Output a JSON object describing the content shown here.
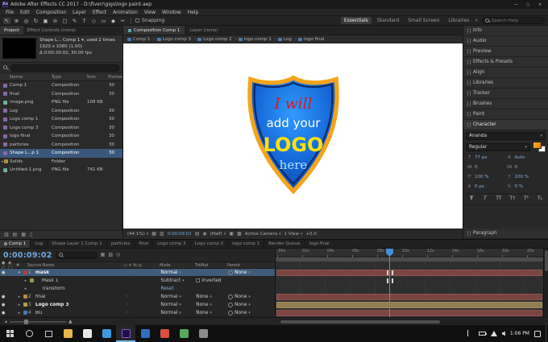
{
  "title_bar": {
    "app_icon": "Ae",
    "title": "Adobe After Effects CC 2017 - D:\\fiverr\\gigs\\logo paint.aep"
  },
  "menu": {
    "items": [
      "File",
      "Edit",
      "Composition",
      "Layer",
      "Effect",
      "Animation",
      "View",
      "Window",
      "Help"
    ]
  },
  "icons": {
    "minimize": "—",
    "maximize": "▢",
    "close": "✕",
    "selection_tool": "↖",
    "hand_tool": "⊕",
    "zoom_tool": "◎",
    "rotate_tool": "↻",
    "camera_tool": "▣",
    "pan_behind_tool": "⊘",
    "mask_tool": "□",
    "pen_tool": "✎",
    "type_tool": "T",
    "brush_tool": "◇",
    "clone_tool": "▭",
    "eraser_tool": "◆",
    "roto_tool": "✂",
    "workspace_more": "»",
    "grid_icon": "▦",
    "region_icon": "▧",
    "snapshot_icon": "▤",
    "channels_icon": "◉",
    "interpret_icon": "▥",
    "newfolder_icon": "▤",
    "newcomp_icon": "▦",
    "trash_icon": "▯",
    "eye": "●",
    "audio_icons": "● ◉ ○ □",
    "switch_icons": "◇ ✶ fx ◎"
  },
  "toolbar": {
    "snapping_label": "Snapping",
    "workspaces": [
      "Essentials",
      "Standard",
      "Small Screen",
      "Libraries"
    ],
    "search_placeholder": "Search Help"
  },
  "project": {
    "tabs": [
      "Project",
      "Effect Controls (none)"
    ],
    "info_line1": "Shape L... Comp 1 ▾, used 2 times",
    "info_line2": "1920 x 1080 (1.00)",
    "info_line3": "Δ 0:00:20:02, 30.00 fps",
    "columns": [
      "Name",
      "Type",
      "Size",
      "Frame.."
    ],
    "rows": [
      {
        "name": "Comp 1",
        "type": "Composition",
        "size": "",
        "frame": "30"
      },
      {
        "name": "final",
        "type": "Composition",
        "size": "",
        "frame": "30"
      },
      {
        "name": "image.png",
        "type": "PNG file",
        "size": "108 KB",
        "frame": ""
      },
      {
        "name": "Log",
        "type": "Composition",
        "size": "",
        "frame": "30"
      },
      {
        "name": "Logo comp 1",
        "type": "Composition",
        "size": "",
        "frame": "30"
      },
      {
        "name": "Logo comp 3",
        "type": "Composition",
        "size": "",
        "frame": "30"
      },
      {
        "name": "logo final",
        "type": "Composition",
        "size": "",
        "frame": "30"
      },
      {
        "name": "particles",
        "type": "Composition",
        "size": "",
        "frame": "30"
      },
      {
        "name": "Shape L...p 1",
        "type": "Composition",
        "size": "",
        "frame": "30"
      },
      {
        "name": "Solids",
        "type": "Folder",
        "size": "",
        "frame": ""
      },
      {
        "name": "Untitled-1.png",
        "type": "PNG file",
        "size": "741 KB",
        "frame": ""
      }
    ]
  },
  "viewer": {
    "tabs": [
      "Composition Comp 1",
      "Layer (none)"
    ],
    "breadcrumb": [
      "Comp 1",
      "Logo comp 3",
      "Logo comp 2",
      "logo comp 1",
      "Log",
      "logo final"
    ],
    "zoom": "(44.1%)",
    "timecode": "0:00:09:02",
    "resolution": "(Half)",
    "camera": "Active Camera",
    "views": "1 View",
    "exposure": "+0.0",
    "logo": {
      "line1": "I will",
      "line2": "add your",
      "line3": "LOGO",
      "line4": "here"
    }
  },
  "right_panel": {
    "panels": [
      "Info",
      "Audio",
      "Preview",
      "Effects & Presets",
      "Align",
      "Libraries",
      "Tracker",
      "Brushes",
      "Paint"
    ],
    "character": {
      "title": "Character",
      "font_family": "Ananda",
      "font_style": "Regular",
      "font_size": "77 px",
      "leading": "Auto",
      "kerning": "0",
      "tracking": "0",
      "vertical_scale": "100 %",
      "horizontal_scale": "100 %",
      "baseline_shift": "0 px",
      "tsume": "0 %"
    },
    "paragraph_title": "Paragraph"
  },
  "timeline": {
    "timecode": "0:00:09:02",
    "tabs": [
      "Comp 1",
      "Log",
      "Shape Layer 1 Comp 1",
      "particles",
      "final",
      "Logo comp 3",
      "Logo comp 2",
      "logo comp 1",
      "Render Queue",
      "logo final"
    ],
    "columns": {
      "num": "#",
      "source": "Source Name",
      "mode": "Mode",
      "t": "T",
      "trkmat": "TrkMat",
      "parent": "Parent"
    },
    "layers": [
      {
        "num": "1",
        "name": "mask",
        "mode": "Normal",
        "trkmat": "",
        "parent": "None",
        "label_color": "#b43c3c"
      },
      {
        "name": "Mask 1",
        "mode": "Subtract",
        "check_label": "Inverted",
        "label_color": "#9a9a4a"
      },
      {
        "name": "Transform",
        "reset_label": "Reset"
      },
      {
        "num": "2",
        "name": "final",
        "mode": "Normal",
        "trkmat": "None",
        "parent": "None",
        "label_color": "#c08840"
      },
      {
        "num": "3",
        "name": "Logo comp 3",
        "mode": "Normal",
        "trkmat": "None",
        "parent": "None",
        "label_color": "#b0a050"
      },
      {
        "num": "4",
        "name": "BG",
        "mode": "Normal",
        "trkmat": "None",
        "parent": "None",
        "label_color": "#4a78b8"
      }
    ],
    "ruler_ticks": [
      ":00s",
      "02s",
      "04s",
      "06s",
      "08s",
      "10s",
      "12s",
      "14s",
      "16s",
      "18s",
      "20s"
    ]
  },
  "taskbar": {
    "time": "1:06 PM"
  }
}
